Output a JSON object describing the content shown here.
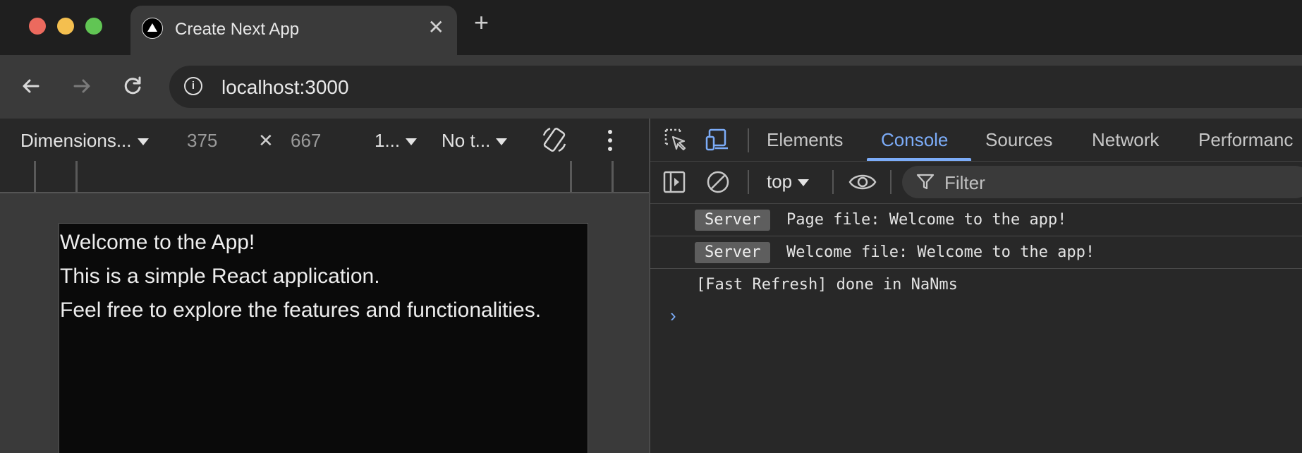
{
  "browser": {
    "tab_title": "Create Next App",
    "tab_close": "✕",
    "new_tab": "+",
    "url": "localhost:3000",
    "info_icon": "i"
  },
  "device_toolbar": {
    "dimensions_label": "Dimensions...",
    "width": "375",
    "times": "✕",
    "height": "667",
    "zoom_label": "1...",
    "throttle_label": "No t..."
  },
  "viewport_content": {
    "line1": "Welcome to the App!",
    "line2": "This is a simple React application.",
    "line3": "Feel free to explore the features and functionalities."
  },
  "devtools": {
    "tabs": [
      "Elements",
      "Console",
      "Sources",
      "Network",
      "Performanc"
    ],
    "active_tab": "Console",
    "context": "top",
    "filter_placeholder": "Filter",
    "logs": [
      {
        "badge": "Server",
        "text": "Page file: Welcome to the app!"
      },
      {
        "badge": "Server",
        "text": "Welcome file: Welcome to the app!"
      },
      {
        "badge": "",
        "text": "[Fast Refresh] done in NaNms"
      }
    ],
    "prompt": "›"
  },
  "colors": {
    "accent": "#7cacf8",
    "traffic_red": "#ec6a5e",
    "traffic_yellow": "#f4bf4f",
    "traffic_green": "#61c554"
  }
}
